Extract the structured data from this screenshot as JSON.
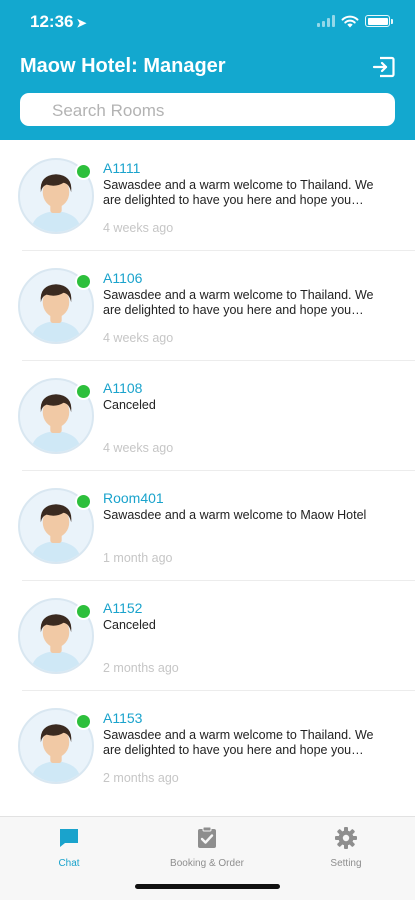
{
  "status_bar": {
    "time": "12:36"
  },
  "header": {
    "title": "Maow Hotel: Manager",
    "search_placeholder": "Search Rooms",
    "bg_color": "#13a8cf"
  },
  "icons": {
    "logout": "logout-icon",
    "chat": "chat-bubble-icon",
    "booking": "clipboard-check-icon",
    "setting": "gear-icon"
  },
  "colors": {
    "accent": "#1aa3cc",
    "online": "#2dbf3c"
  },
  "chats": [
    {
      "room": "A1111",
      "message": "Sawasdee and a warm welcome to Thailand. We are delighted to have you here and hope you enjoy your stay",
      "time": "4 weeks ago"
    },
    {
      "room": "A1106",
      "message": "Sawasdee and a warm welcome to Thailand. We are delighted to have you here and hope you enjoy your stay",
      "time": "4 weeks ago"
    },
    {
      "room": "A1108",
      "message": "Canceled",
      "time": "4 weeks ago"
    },
    {
      "room": "Room401",
      "message": "Sawasdee and a warm welcome to Maow Hotel",
      "time": "1 month ago"
    },
    {
      "room": "A1152",
      "message": "Canceled",
      "time": "2 months ago"
    },
    {
      "room": "A1153",
      "message": "Sawasdee and a warm welcome to Thailand. We are delighted to have you here and hope you enjoy your stay",
      "time": "2 months ago"
    }
  ],
  "tabs": [
    {
      "label": "Chat",
      "active": true
    },
    {
      "label": "Booking & Order",
      "active": false
    },
    {
      "label": "Setting",
      "active": false
    }
  ]
}
